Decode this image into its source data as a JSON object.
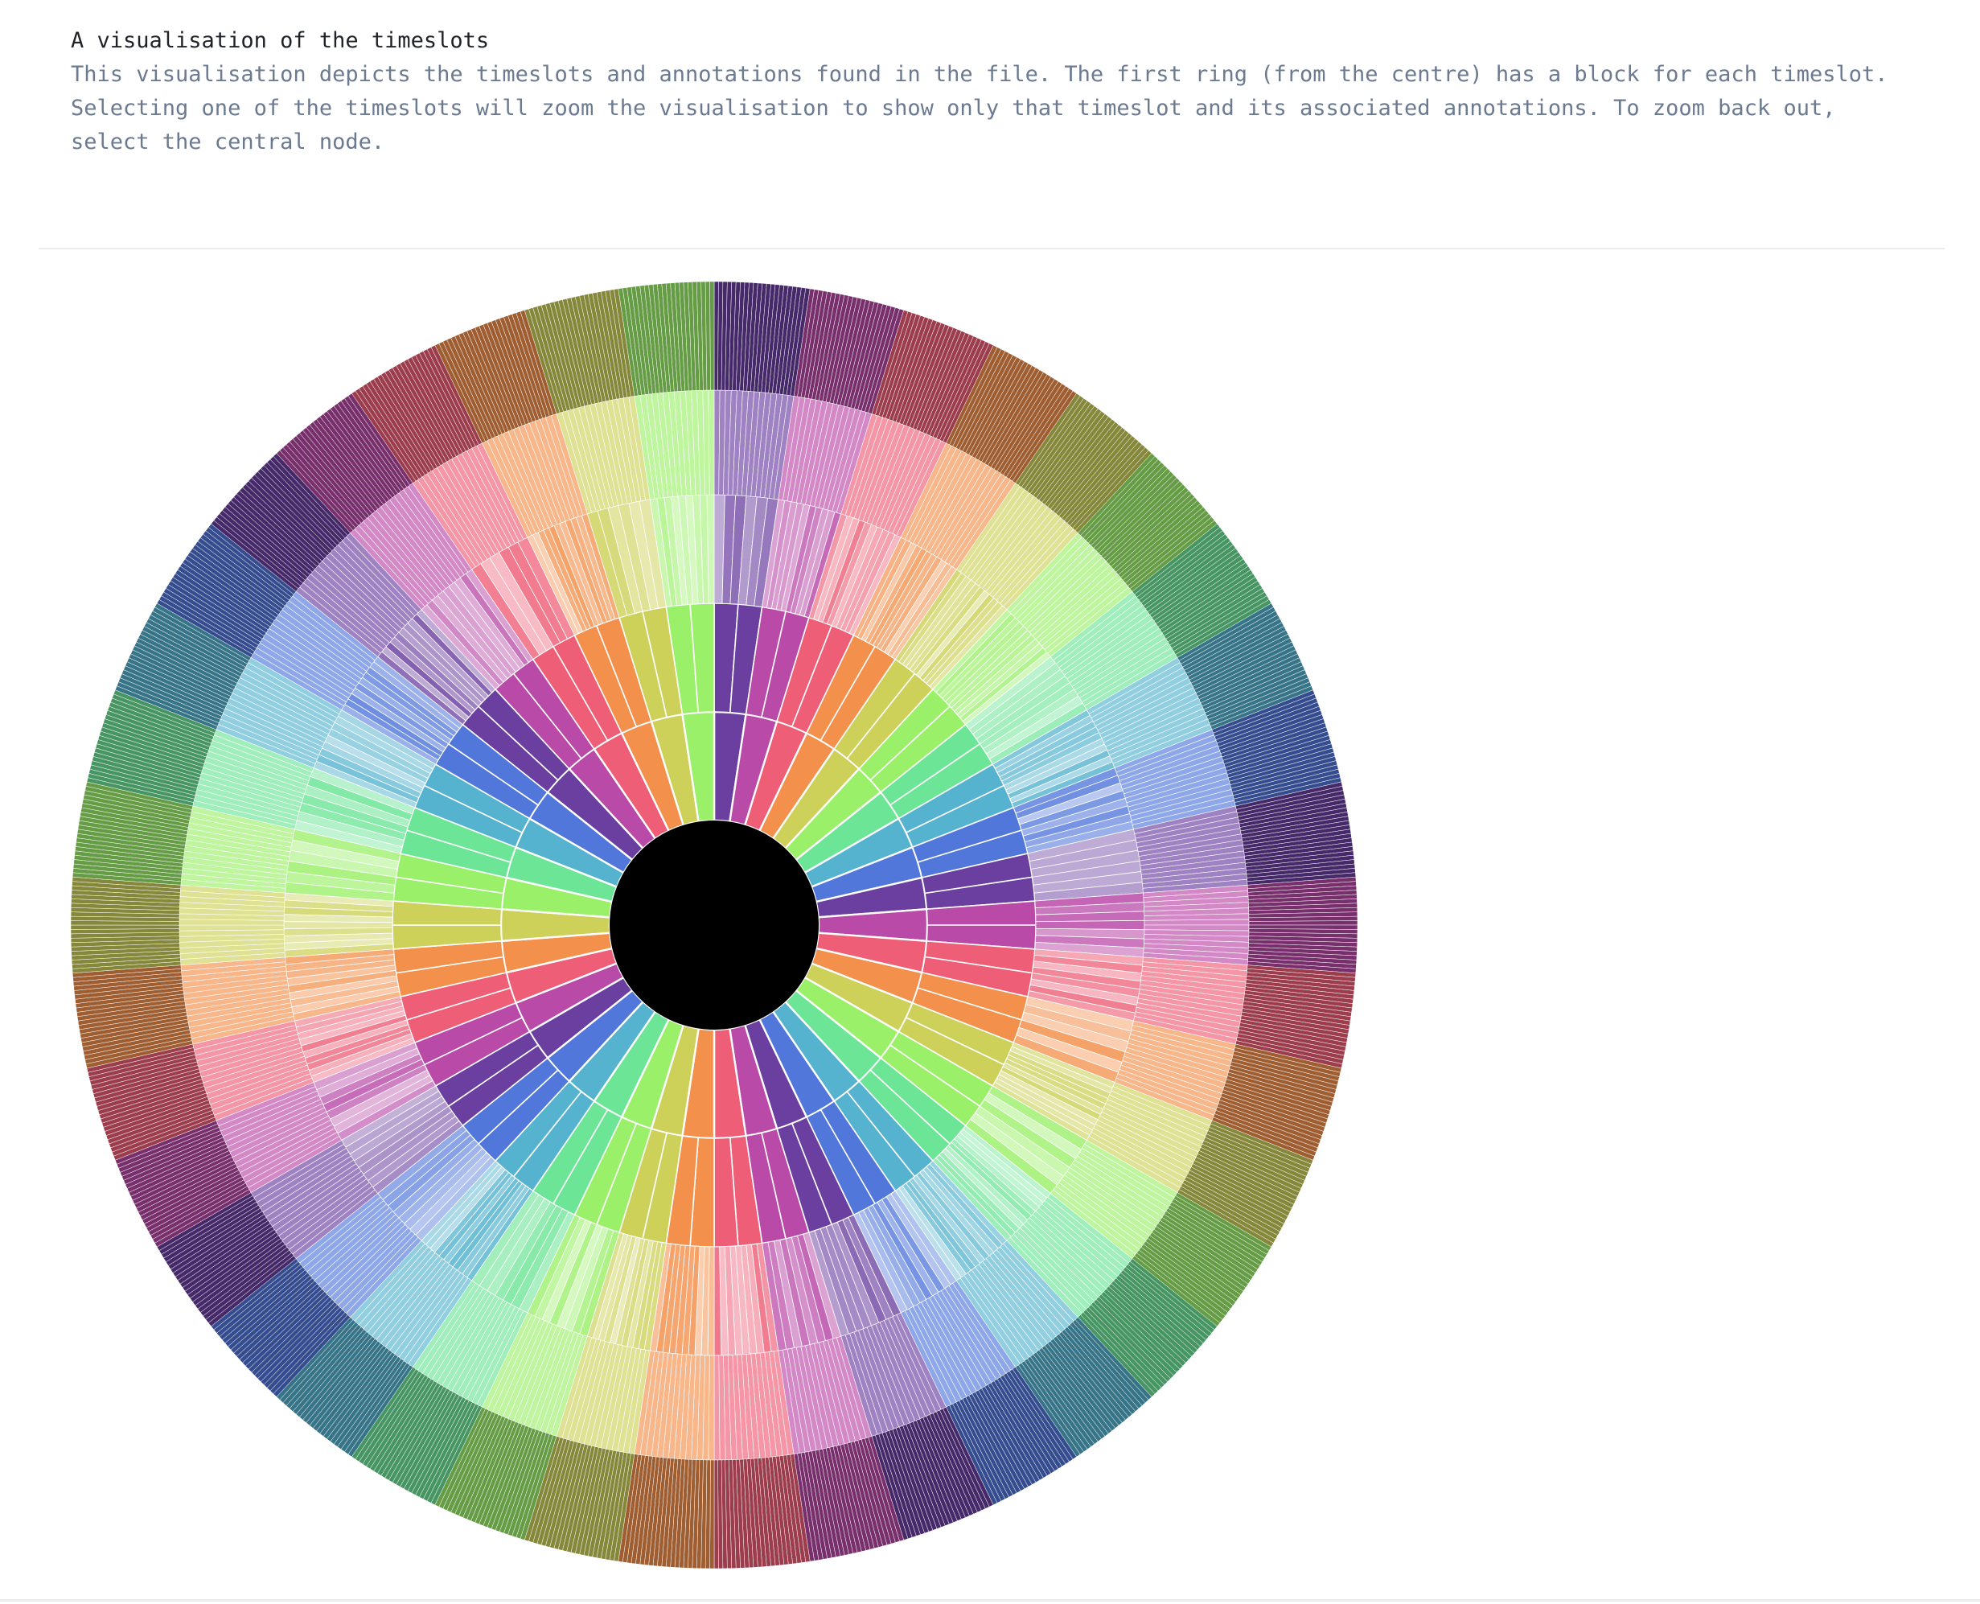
{
  "header": {
    "title": "A visualisation of the timeslots",
    "description": "This visualisation depicts the timeslots and annotations found in the file. The first ring (from the centre) has a block for each timeslot. Selecting one of the timeslots will zoom the visualisation to show only that timeslot and its associated annotations. To zoom back out, select the central node."
  },
  "chart_data": {
    "type": "sunburst",
    "center_node": {
      "color": "#000000"
    },
    "ring_count": 4,
    "first_ring_block_count": 42,
    "palette": [
      "#6a3fa0",
      "#b94aa8",
      "#ee5e76",
      "#f3904c",
      "#cdd15a",
      "#9bf06a",
      "#6ce596",
      "#55b3cf",
      "#5177db"
    ],
    "separator_color": "#ffffff"
  }
}
